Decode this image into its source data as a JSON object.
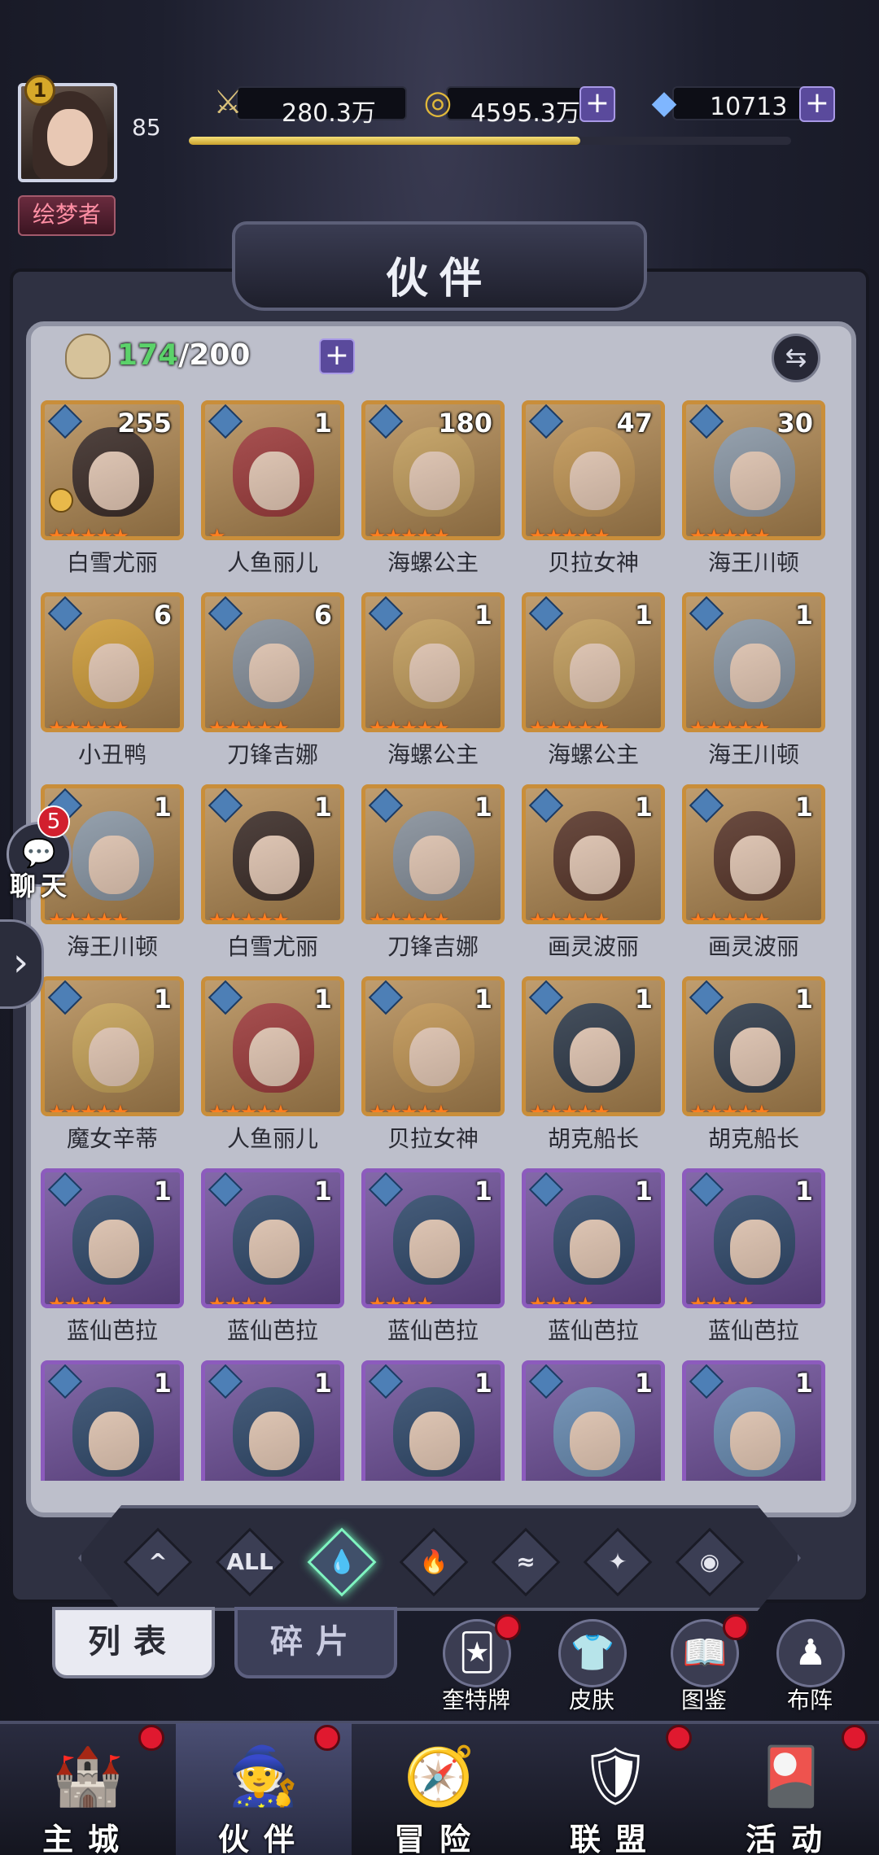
{
  "player": {
    "rank": "1",
    "level": "85",
    "title": "绘梦者",
    "xp_fraction": 0.65
  },
  "resources": {
    "power": "280.3万",
    "gold": "4595.3万",
    "diamonds": "10713"
  },
  "header": {
    "title": "伙伴"
  },
  "roster": {
    "current": "174",
    "max": "/200"
  },
  "colors": {
    "card_gold": "#c98e3a",
    "card_purple": "#8c5bbd",
    "star": "#ff7e1f",
    "active_filter": "#7ff4c0"
  },
  "partners": [
    {
      "name": "白雪尤丽",
      "level": "255",
      "stars": 5,
      "frame": "gold",
      "tone": "#3b2b26"
    },
    {
      "name": "人鱼丽儿",
      "level": "1",
      "stars": 1,
      "frame": "gold",
      "tone": "#a33b3b"
    },
    {
      "name": "海螺公主",
      "level": "180",
      "stars": 5,
      "frame": "gold",
      "tone": "#caa35e"
    },
    {
      "name": "贝拉女神",
      "level": "47",
      "stars": 5,
      "frame": "gold",
      "tone": "#c99b56"
    },
    {
      "name": "海王川顿",
      "level": "30",
      "stars": 5,
      "frame": "gold",
      "tone": "#8e9cab"
    },
    {
      "name": "小丑鸭",
      "level": "6",
      "stars": 5,
      "frame": "gold",
      "tone": "#d7a23a"
    },
    {
      "name": "刀锋吉娜",
      "level": "6",
      "stars": 5,
      "frame": "gold",
      "tone": "#8a94a0"
    },
    {
      "name": "海螺公主",
      "level": "1",
      "stars": 5,
      "frame": "gold",
      "tone": "#caa35e"
    },
    {
      "name": "海螺公主",
      "level": "1",
      "stars": 5,
      "frame": "gold",
      "tone": "#caa35e"
    },
    {
      "name": "海王川顿",
      "level": "1",
      "stars": 5,
      "frame": "gold",
      "tone": "#8e9cab"
    },
    {
      "name": "海王川顿",
      "level": "1",
      "stars": 5,
      "frame": "gold",
      "tone": "#8e9cab"
    },
    {
      "name": "白雪尤丽",
      "level": "1",
      "stars": 5,
      "frame": "gold",
      "tone": "#3b2b26"
    },
    {
      "name": "刀锋吉娜",
      "level": "1",
      "stars": 5,
      "frame": "gold",
      "tone": "#8a94a0"
    },
    {
      "name": "画灵波丽",
      "level": "1",
      "stars": 5,
      "frame": "gold",
      "tone": "#5a3528"
    },
    {
      "name": "画灵波丽",
      "level": "1",
      "stars": 5,
      "frame": "gold",
      "tone": "#5a3528"
    },
    {
      "name": "魔女辛蒂",
      "level": "1",
      "stars": 5,
      "frame": "gold",
      "tone": "#cfa95a"
    },
    {
      "name": "人鱼丽儿",
      "level": "1",
      "stars": 5,
      "frame": "gold",
      "tone": "#a33b3b"
    },
    {
      "name": "贝拉女神",
      "level": "1",
      "stars": 5,
      "frame": "gold",
      "tone": "#c99b56"
    },
    {
      "name": "胡克船长",
      "level": "1",
      "stars": 5,
      "frame": "gold",
      "tone": "#2e3a4a"
    },
    {
      "name": "胡克船长",
      "level": "1",
      "stars": 5,
      "frame": "gold",
      "tone": "#2e3a4a"
    },
    {
      "name": "蓝仙芭拉",
      "level": "1",
      "stars": 4,
      "frame": "purple",
      "tone": "#2f4a6e"
    },
    {
      "name": "蓝仙芭拉",
      "level": "1",
      "stars": 4,
      "frame": "purple",
      "tone": "#2f4a6e"
    },
    {
      "name": "蓝仙芭拉",
      "level": "1",
      "stars": 4,
      "frame": "purple",
      "tone": "#2f4a6e"
    },
    {
      "name": "蓝仙芭拉",
      "level": "1",
      "stars": 4,
      "frame": "purple",
      "tone": "#2f4a6e"
    },
    {
      "name": "蓝仙芭拉",
      "level": "1",
      "stars": 4,
      "frame": "purple",
      "tone": "#2f4a6e"
    },
    {
      "name": "",
      "level": "1",
      "stars": 0,
      "frame": "purple",
      "tone": "#2f4a6e"
    },
    {
      "name": "",
      "level": "1",
      "stars": 0,
      "frame": "purple",
      "tone": "#2f4a6e"
    },
    {
      "name": "",
      "level": "1",
      "stars": 0,
      "frame": "purple",
      "tone": "#2f4a6e"
    },
    {
      "name": "",
      "level": "1",
      "stars": 0,
      "frame": "purple",
      "tone": "#6a8fb8"
    },
    {
      "name": "",
      "level": "1",
      "stars": 0,
      "frame": "purple",
      "tone": "#6a8fb8"
    }
  ],
  "filters": [
    {
      "id": "filter-wind",
      "glyph": "^",
      "active": false
    },
    {
      "id": "filter-all",
      "glyph": "ALL",
      "active": false
    },
    {
      "id": "filter-water",
      "glyph": "💧",
      "active": true
    },
    {
      "id": "filter-fire",
      "glyph": "🔥",
      "active": false
    },
    {
      "id": "filter-earth",
      "glyph": "≈",
      "active": false
    },
    {
      "id": "filter-light",
      "glyph": "✦",
      "active": false
    },
    {
      "id": "filter-dark",
      "glyph": "◉",
      "active": false
    }
  ],
  "tabs": {
    "list": "列表",
    "fragments": "碎片"
  },
  "quick": [
    {
      "label": "奎特牌",
      "icon": "🃏",
      "dot": true
    },
    {
      "label": "皮肤",
      "icon": "👕",
      "dot": false
    },
    {
      "label": "图鉴",
      "icon": "📖",
      "dot": true
    },
    {
      "label": "布阵",
      "icon": "♟",
      "dot": false
    }
  ],
  "chat": {
    "label": "聊天",
    "badge": "5"
  },
  "nav": [
    {
      "label": "主城",
      "icon": "🏰",
      "dot": true,
      "active": false
    },
    {
      "label": "伙伴",
      "icon": "🧙",
      "dot": true,
      "active": true
    },
    {
      "label": "冒险",
      "icon": "🧭",
      "dot": false,
      "active": false
    },
    {
      "label": "联盟",
      "icon": "🛡",
      "dot": true,
      "active": false
    },
    {
      "label": "活动",
      "icon": "🎴",
      "dot": true,
      "active": false
    }
  ]
}
